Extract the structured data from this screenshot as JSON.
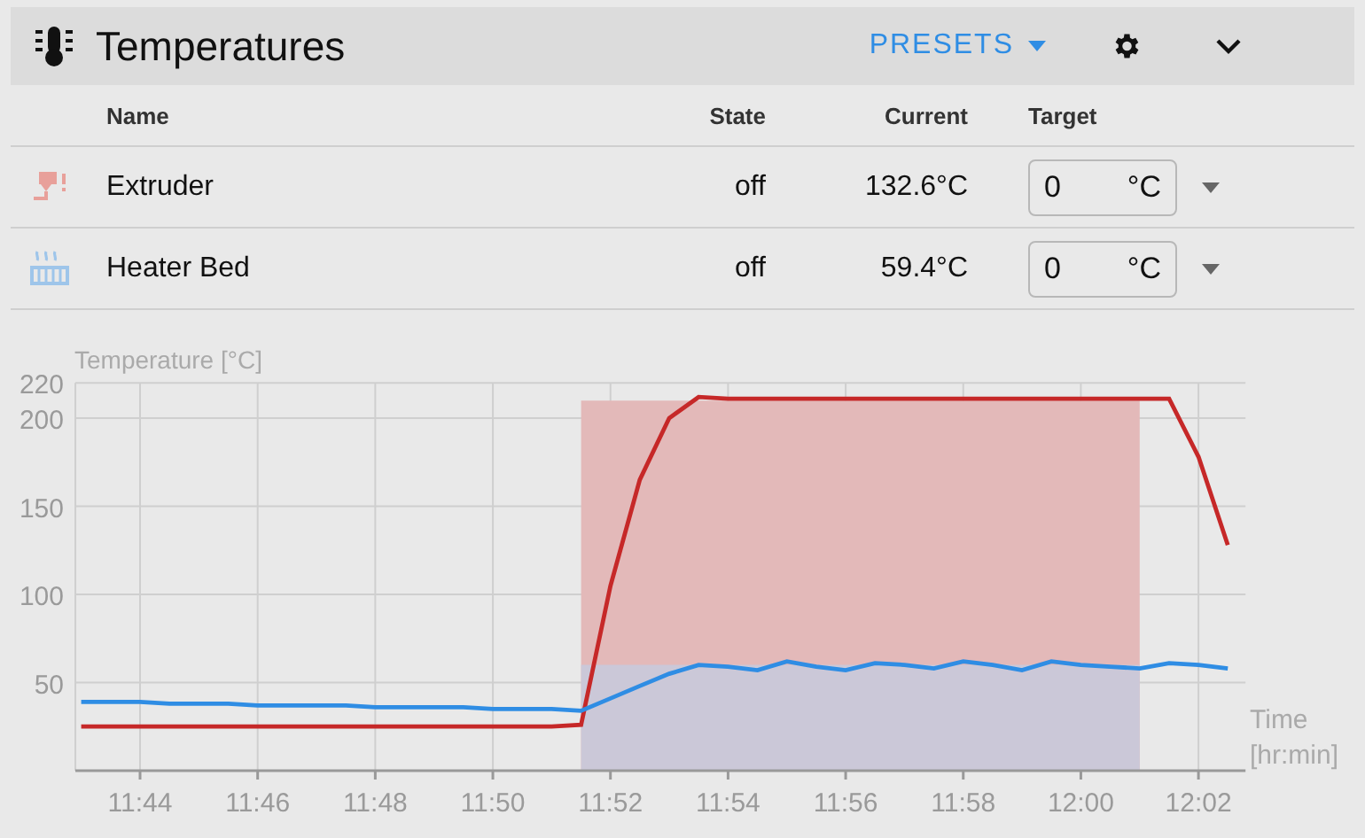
{
  "header": {
    "title": "Temperatures",
    "presets_button": "PRESETS"
  },
  "table": {
    "columns": [
      "Name",
      "State",
      "Current",
      "Target"
    ],
    "rows": [
      {
        "kind": "extruder",
        "name": "Extruder",
        "state": "off",
        "current": "132.6°C",
        "target": "0",
        "unit": "°C"
      },
      {
        "kind": "bed",
        "name": "Heater Bed",
        "state": "off",
        "current": "59.4°C",
        "target": "0",
        "unit": "°C"
      }
    ]
  },
  "chart": {
    "chart_data": {
      "type": "line",
      "ylabel": "Temperature [°C]",
      "xlabel": "Time [hr:min]",
      "categories": [
        null,
        null,
        "11:44",
        null,
        null,
        null,
        "11:46",
        null,
        null,
        null,
        "11:48",
        null,
        null,
        null,
        "11:50",
        null,
        null,
        null,
        "11:52",
        null,
        null,
        null,
        "11:54",
        null,
        null,
        null,
        "11:56",
        null,
        null,
        null,
        "11:58",
        null,
        null,
        null,
        "12:00",
        null,
        null,
        null,
        "12:02",
        null
      ],
      "series": [
        {
          "type": "area",
          "color": "#e3b9b9",
          "values": [
            null,
            null,
            null,
            null,
            null,
            null,
            null,
            null,
            null,
            null,
            null,
            null,
            null,
            null,
            null,
            null,
            null,
            210,
            210,
            210,
            210,
            210,
            210,
            210,
            210,
            210,
            210,
            210,
            210,
            210,
            210,
            210,
            210,
            210,
            210,
            210,
            210,
            null,
            null,
            null
          ]
        },
        {
          "type": "area",
          "color": "#cbc8d8",
          "values": [
            null,
            null,
            null,
            null,
            null,
            null,
            null,
            null,
            null,
            null,
            null,
            null,
            null,
            null,
            null,
            null,
            null,
            60,
            60,
            60,
            60,
            60,
            60,
            60,
            60,
            60,
            60,
            60,
            60,
            60,
            60,
            60,
            60,
            60,
            60,
            60,
            60,
            null,
            null,
            null
          ]
        },
        {
          "color": "#c62828",
          "values": [
            25,
            25,
            25,
            25,
            25,
            25,
            25,
            25,
            25,
            25,
            25,
            25,
            25,
            25,
            25,
            25,
            25,
            26,
            105,
            165,
            200,
            212,
            211,
            211,
            211,
            211,
            211,
            211,
            211,
            211,
            211,
            211,
            211,
            211,
            211,
            211,
            211,
            211,
            178,
            128
          ]
        },
        {
          "color": "#2f8de4",
          "values": [
            39,
            39,
            39,
            38,
            38,
            38,
            37,
            37,
            37,
            37,
            36,
            36,
            36,
            36,
            35,
            35,
            35,
            34,
            41,
            48,
            55,
            60,
            59,
            57,
            62,
            59,
            57,
            61,
            60,
            58,
            62,
            60,
            57,
            62,
            60,
            59,
            58,
            61,
            60,
            58
          ]
        }
      ],
      "grid": true,
      "ylim": [
        0,
        220
      ],
      "yticks": [
        50,
        100,
        150,
        200,
        220
      ]
    }
  }
}
